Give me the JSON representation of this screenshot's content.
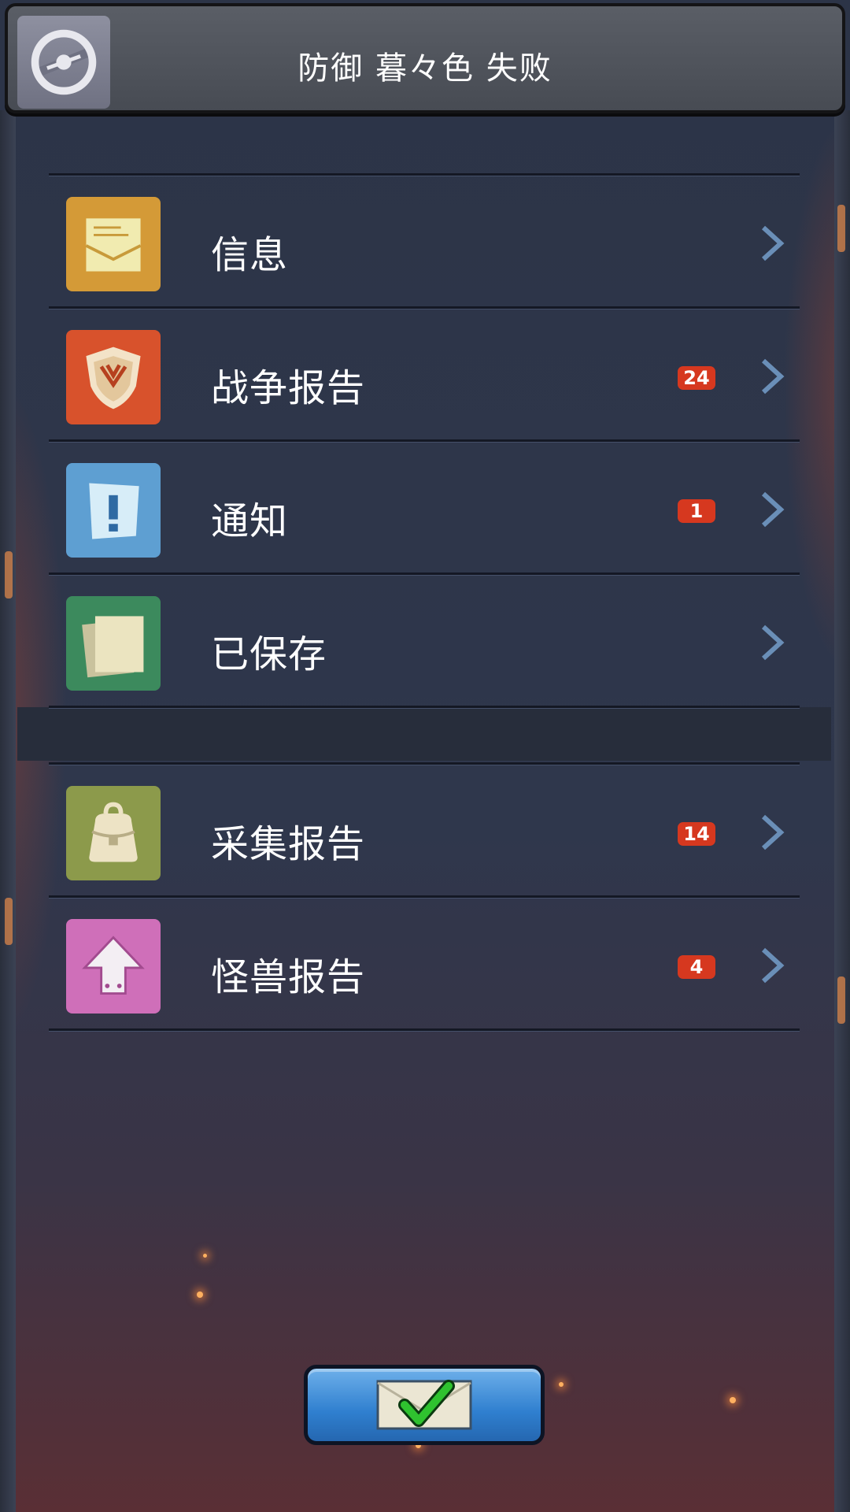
{
  "header": {
    "title": "防御 暮々色 失败",
    "logo_icon": "alliance-emblem-icon"
  },
  "menu": {
    "items": [
      {
        "label": "信息",
        "icon": "message-envelope-icon",
        "badge": null,
        "color": "#d49a37"
      },
      {
        "label": "战争报告",
        "icon": "war-shield-icon",
        "badge": "24",
        "color": "#d8522c"
      },
      {
        "label": "通知",
        "icon": "notice-exclamation-icon",
        "badge": "1",
        "color": "#5e9fd2"
      },
      {
        "label": "已保存",
        "icon": "saved-pages-icon",
        "badge": null,
        "color": "#3c8a5d"
      },
      {
        "label": "采集报告",
        "icon": "gather-bag-icon",
        "badge": "14",
        "color": "#8c9a4b"
      },
      {
        "label": "怪兽报告",
        "icon": "monster-arrow-icon",
        "badge": "4",
        "color": "#cf6fb9"
      }
    ]
  },
  "footer": {
    "confirm_icon": "envelope-check-icon"
  },
  "colors": {
    "badge": "#d6381f",
    "panel": "#2f374c",
    "chevron": "#6a8fb8"
  }
}
